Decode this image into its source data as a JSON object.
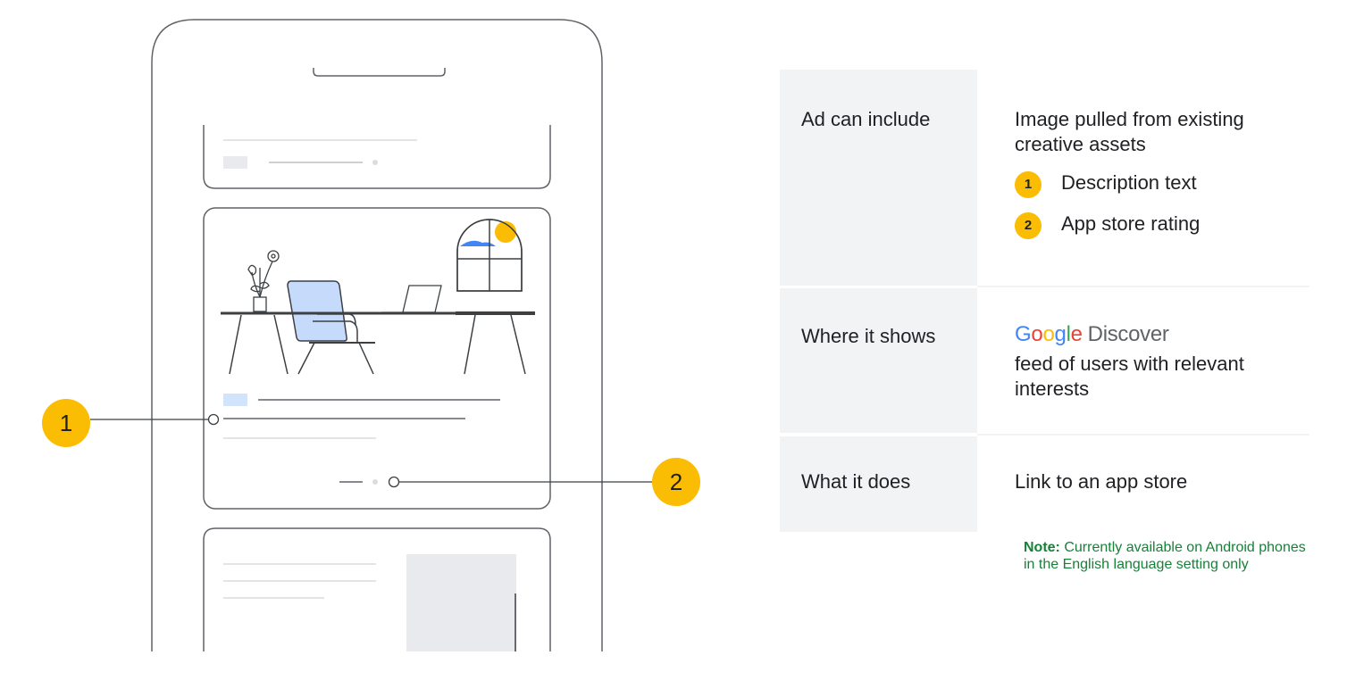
{
  "callouts": {
    "badge_1": "1",
    "badge_2": "2"
  },
  "table": {
    "rows": [
      {
        "label": "Ad can include",
        "value_lines": [
          "Image pulled from existing",
          "creative assets"
        ],
        "items": [
          {
            "number": "1",
            "text": "Description text"
          },
          {
            "number": "2",
            "text": "App store rating"
          }
        ]
      },
      {
        "label": "Where it shows",
        "brand": {
          "letters": [
            "G",
            "o",
            "o",
            "g",
            "l",
            "e"
          ],
          "product": "Discover"
        },
        "value_lines": [
          "feed of users with relevant",
          "interests"
        ]
      },
      {
        "label": "What it does",
        "value_lines": [
          "Link to an app store"
        ]
      }
    ]
  },
  "note": {
    "prefix": "Note:",
    "text": " Currently available on Android phones in the English language setting only"
  },
  "colors": {
    "accent_yellow": "#fbbc04",
    "label_bg": "#f1f3f4",
    "note_green": "#188038",
    "chair_blue": "#c6dafc",
    "google_blue": "#4285f4",
    "google_red": "#ea4335",
    "google_yellow": "#fbbc04",
    "google_green": "#34a853"
  }
}
